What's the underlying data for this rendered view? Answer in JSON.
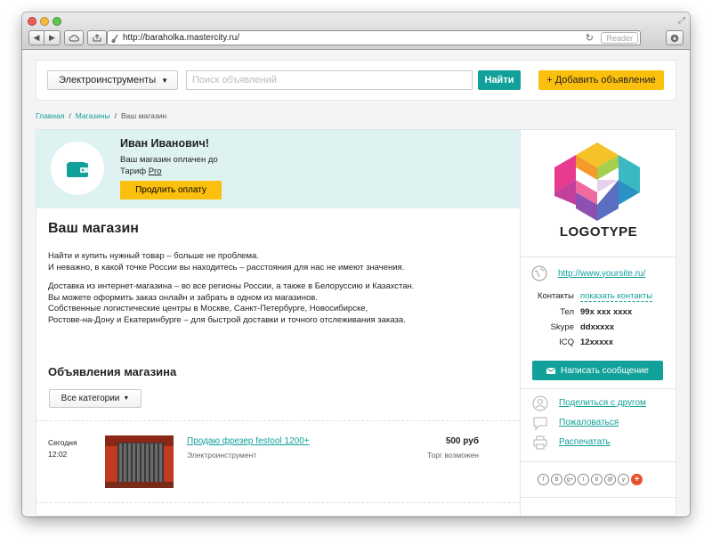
{
  "browser": {
    "url": "http://baraholka.mastercity.ru/",
    "reader_label": "Reader",
    "traffic_colors": [
      "#ee5c55",
      "#f4bb3e",
      "#5ec54d"
    ]
  },
  "header": {
    "category_select": "Электроинструменты",
    "search_placeholder": "Поиск объявлений",
    "find_button": "Найти",
    "add_button": "+ Добавить объявление"
  },
  "breadcrumb": {
    "items": [
      "Главная",
      "Магазины"
    ],
    "current": "Ваш магазин",
    "separator": "/"
  },
  "notice": {
    "title": "Иван Иванович!",
    "line1": "Ваш магазин оплачен до",
    "tariff_label": "Тариф",
    "tariff_value": "Pro",
    "extend_button": "Продлить оплату"
  },
  "shop": {
    "title": "Ваш магазин",
    "para1": [
      "Найти и купить нужный товар – больше не проблема.",
      "И неважно, в какой точке России вы находитесь – расстояния для нас не имеют значения."
    ],
    "para2": [
      "Доставка из интернет-магазина – во все регионы России, а также в Белоруссию и Казахстан.",
      "Вы можете оформить заказ онлайн и забрать в одном из магазинов.",
      "Собственные логистические центры в Москве, Санкт-Петербурге, Новосибирске,",
      "Ростове-на-Дону и Екатеринбурге – для быстрой доставки и точного отслеживания заказа."
    ]
  },
  "ads": {
    "title": "Объявления магазина",
    "filter": "Все категории",
    "items": [
      {
        "date": "Сегодня",
        "time": "12:02",
        "title": "Продаю фрезер festool 1200+",
        "category": "Электроинструмент",
        "price": "500 руб",
        "note": "Торг возможен"
      }
    ]
  },
  "sidebar": {
    "logotype": "LOGOTYPE",
    "website": "http://www.yoursite.ru/",
    "contacts_label": "Контакты",
    "contacts_link": "показать контакты",
    "phone_label": "Тел",
    "phone_value": "99x xxx xxxx",
    "skype_label": "Skype",
    "skype_value": "ddxxxxx",
    "icq_label": "ICQ",
    "icq_value": "12xxxxx",
    "write_button": "Написать сообщение",
    "share": "Поделиться с другом",
    "complain": "Пожаловаться",
    "print": "Распечатать",
    "socials": [
      "f",
      "B",
      "g+",
      "t",
      "8",
      "@",
      "y",
      "+"
    ]
  },
  "colors": {
    "accent": "#12a19a",
    "yellow": "#fbbf0d",
    "notice_bg": "#def2f2"
  }
}
